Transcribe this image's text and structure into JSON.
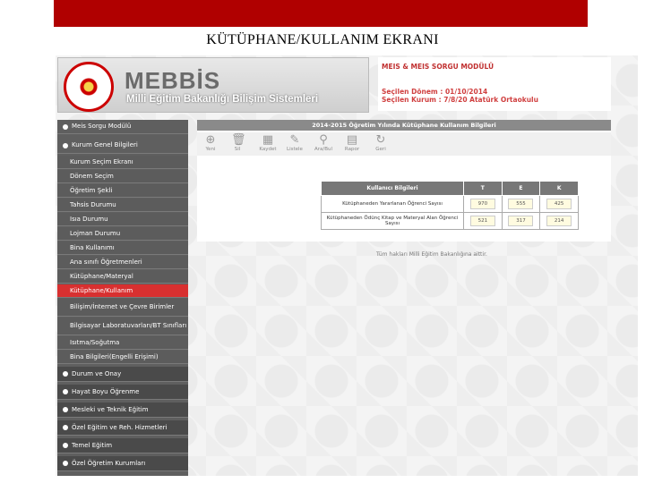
{
  "slide": {
    "title": "KÜTÜPHANE/KULLANIM EKRANI"
  },
  "header": {
    "brand": "MEBBİS",
    "brand_subtitle": "Milli Eğitim Bakanlığı Bilişim Sistemleri",
    "module_title": "MEIS & MEIS SORGU MODÜLÜ",
    "selected_period": "Seçilen Dönem : 01/10/2014",
    "selected_institution": "Seçilen Kurum : 7/8/20 Atatürk Ortaokulu"
  },
  "sidebar": {
    "items": [
      {
        "label": "Meis Sorgu Modülü",
        "type": "main",
        "active": false
      },
      {
        "label": "Kurum Genel Bilgileri",
        "type": "main",
        "active": true
      },
      {
        "label": "Kurum Seçim Ekranı",
        "type": "sub",
        "active": false
      },
      {
        "label": "Dönem Seçim",
        "type": "sub",
        "active": false
      },
      {
        "label": "Öğretim Şekli",
        "type": "sub",
        "active": false
      },
      {
        "label": "Tahsis Durumu",
        "type": "sub",
        "active": false
      },
      {
        "label": "Isıa Durumu",
        "type": "sub",
        "active": false
      },
      {
        "label": "Lojman Durumu",
        "type": "sub",
        "active": false
      },
      {
        "label": "Bina Kullanımı",
        "type": "sub",
        "active": false
      },
      {
        "label": "Ana sınıfı Öğretmenleri",
        "type": "sub",
        "active": false
      },
      {
        "label": "Kütüphane/Materyal",
        "type": "sub",
        "active": false
      },
      {
        "label": "Kütüphane/Kullanım",
        "type": "sub",
        "active": true
      },
      {
        "label": "Bilişim/İnternet ve Çevre Birimler",
        "type": "sub",
        "active": false
      },
      {
        "label": "Bilgisayar Laboratuvarları/BT Sınıfları",
        "type": "sub",
        "active": false
      },
      {
        "label": "Isıtma/Soğutma",
        "type": "sub",
        "active": false
      },
      {
        "label": "Bina Bilgileri(Engelli Erişimi)",
        "type": "sub",
        "active": false
      },
      {
        "label": "Durum ve Onay",
        "type": "main",
        "active": false
      },
      {
        "label": "Hayat Boyu Öğrenme",
        "type": "main",
        "active": false
      },
      {
        "label": "Mesleki ve Teknik Eğitim",
        "type": "main",
        "active": false
      },
      {
        "label": "Özel Eğitim ve Reh. Hizmetleri",
        "type": "main",
        "active": false
      },
      {
        "label": "Temel Eğitim",
        "type": "main",
        "active": false
      },
      {
        "label": "Özel Öğretim Kurumları",
        "type": "main",
        "active": false
      }
    ]
  },
  "content": {
    "header": "2014-2015 Öğretim Yılında Kütüphane Kullanım Bilgileri",
    "toolbar": [
      {
        "label": "Yeni",
        "icon": "plus-icon"
      },
      {
        "label": "Sil",
        "icon": "trash-icon"
      },
      {
        "label": "Kaydet",
        "icon": "save-icon"
      },
      {
        "label": "Listele",
        "icon": "edit-icon"
      },
      {
        "label": "Ara/Bul",
        "icon": "search-icon"
      },
      {
        "label": "Rapor",
        "icon": "report-icon"
      },
      {
        "label": "Geri",
        "icon": "refresh-icon"
      }
    ],
    "table": {
      "headers": [
        "Kullanıcı Bilgileri",
        "T",
        "E",
        "K"
      ],
      "rows": [
        {
          "label": "Kütüphaneden Yararlanan Öğrenci Sayısı",
          "values": [
            "970",
            "555",
            "425"
          ]
        },
        {
          "label": "Kütüphaneden Ödünç Kitap ve Materyal Alan Öğrenci Sayısı",
          "values": [
            "521",
            "317",
            "214"
          ]
        }
      ]
    },
    "footer": "Tüm hakları Milli Eğitim Bakanlığına aittir."
  }
}
